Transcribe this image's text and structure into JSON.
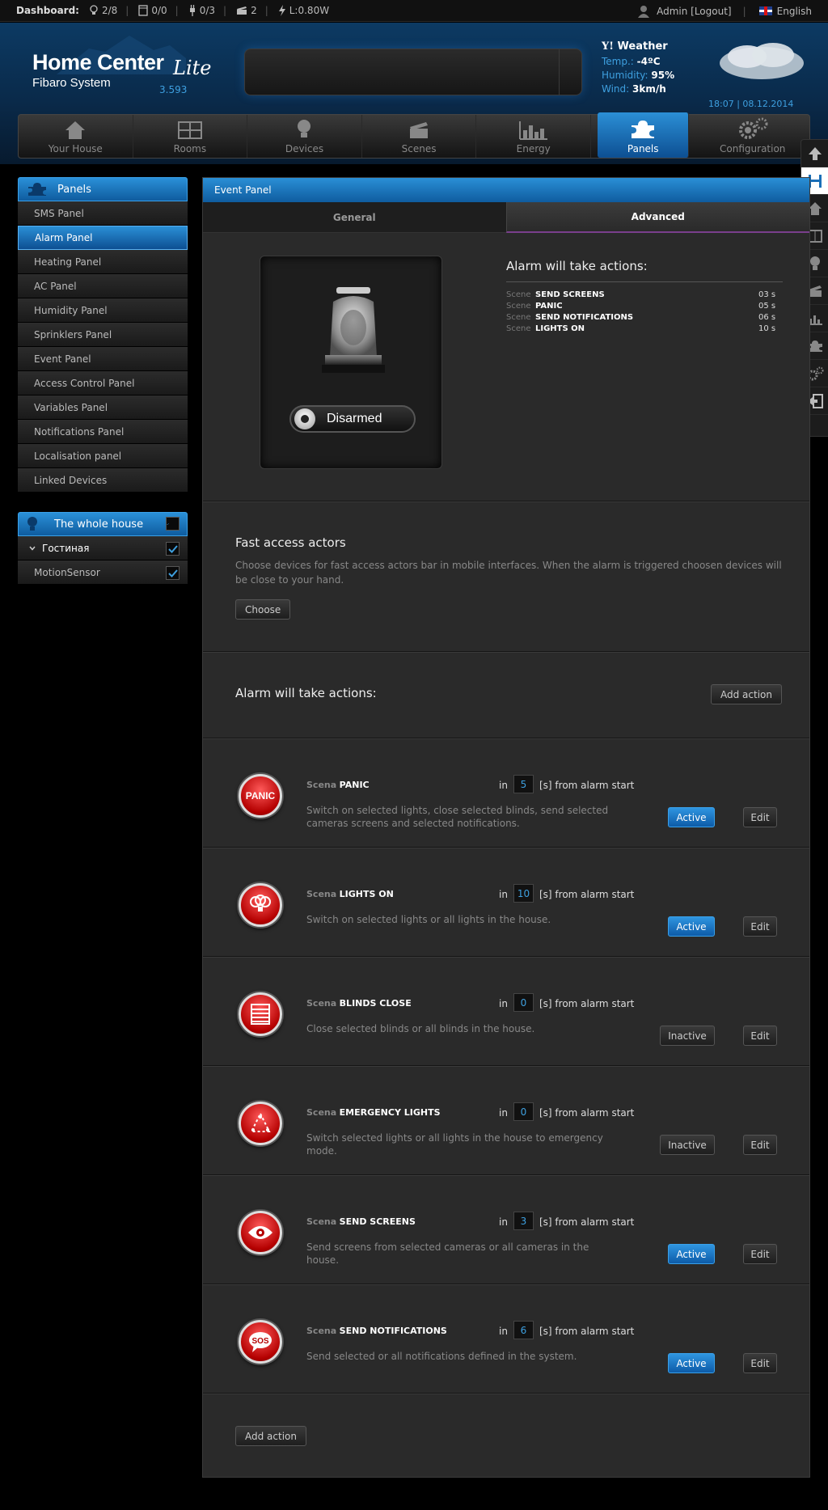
{
  "statusbar": {
    "dashboard_label": "Dashboard:",
    "lights": "2/8",
    "blinds": "0/0",
    "plugs": "0/3",
    "scenes": "2",
    "power": "L:0.80W",
    "user": "Admin [Logout]",
    "language": "English"
  },
  "header": {
    "logo_title": "Home Center",
    "logo_lite": "Lite",
    "logo_sub": "Fibaro System",
    "version": "3.593",
    "weather": {
      "title": "Weather",
      "temp_label": "Temp.:",
      "temp_value": "-4ºC",
      "humidity_label": "Humidity:",
      "humidity_value": "95%",
      "wind_label": "Wind:",
      "wind_value": "3km/h"
    },
    "datetime": "18:07 | 08.12.2014"
  },
  "nav": {
    "items": [
      {
        "label": "Your House"
      },
      {
        "label": "Rooms"
      },
      {
        "label": "Devices"
      },
      {
        "label": "Scenes"
      },
      {
        "label": "Energy"
      },
      {
        "label": "Panels"
      },
      {
        "label": "Configuration"
      }
    ]
  },
  "sidebar": {
    "title": "Panels",
    "items": [
      {
        "label": "SMS Panel"
      },
      {
        "label": "Alarm Panel"
      },
      {
        "label": "Heating Panel"
      },
      {
        "label": "AC Panel"
      },
      {
        "label": "Humidity Panel"
      },
      {
        "label": "Sprinklers Panel"
      },
      {
        "label": "Event Panel"
      },
      {
        "label": "Access Control Panel"
      },
      {
        "label": "Variables Panel"
      },
      {
        "label": "Notifications Panel"
      },
      {
        "label": "Localisation panel"
      },
      {
        "label": "Linked Devices"
      }
    ],
    "house_title": "The whole house",
    "room": "Гостиная",
    "device": "MotionSensor"
  },
  "main": {
    "title": "Event Panel",
    "tabs": [
      {
        "label": "General"
      },
      {
        "label": "Advanced"
      }
    ],
    "alarm_state": "Disarmed",
    "summary_title": "Alarm will take actions:",
    "summary_key": "Scene",
    "summary": [
      {
        "name": "SEND SCREENS",
        "time": "03 s"
      },
      {
        "name": "PANIC",
        "time": "05 s"
      },
      {
        "name": "SEND NOTIFICATIONS",
        "time": "06 s"
      },
      {
        "name": "LIGHTS ON",
        "time": "10 s"
      }
    ],
    "fast_title": "Fast access actors",
    "fast_desc": "Choose devices for fast access actors bar in mobile interfaces. When the alarm is triggered choosen devices will be close to your hand.",
    "choose_label": "Choose",
    "actions_title": "Alarm will take actions:",
    "add_action_label": "Add action",
    "scene_key": "Scena",
    "in_label": "in",
    "from_label": "[s] from alarm start",
    "edit_label": "Edit",
    "scenes": [
      {
        "name": "PANIC",
        "delay": "5",
        "desc": "Switch on selected lights, close selected blinds, send selected cameras screens and selected notifications.",
        "status": "Active",
        "icon": "panic-icon"
      },
      {
        "name": "LIGHTS ON",
        "delay": "10",
        "desc": "Switch on selected lights or all lights in the house.",
        "status": "Active",
        "icon": "bulbs-icon"
      },
      {
        "name": "BLINDS CLOSE",
        "delay": "0",
        "desc": "Close selected blinds or all blinds in the house.",
        "status": "Inactive",
        "icon": "blinds-icon"
      },
      {
        "name": "EMERGENCY LIGHTS",
        "delay": "0",
        "desc": "Switch selected lights or all lights in the house to emergency mode.",
        "status": "Inactive",
        "icon": "emergency-lights-icon"
      },
      {
        "name": "SEND SCREENS",
        "delay": "3",
        "desc": "Send screens from selected cameras or all cameras in the house.",
        "status": "Active",
        "icon": "eye-icon"
      },
      {
        "name": "SEND NOTIFICATIONS",
        "delay": "6",
        "desc": "Send selected or all notifications defined in the system.",
        "status": "Active",
        "icon": "sos-icon"
      }
    ]
  },
  "colors": {
    "accent": "#1a7fd0",
    "scene_red": "#c00000"
  }
}
